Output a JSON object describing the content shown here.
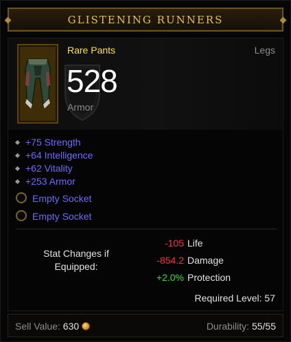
{
  "item": {
    "name": "GLISTENING RUNNERS",
    "rarity_type": "Rare Pants",
    "slot": "Legs",
    "armor_value": "528",
    "armor_label": "Armor"
  },
  "stats": [
    {
      "text": "+75 Strength"
    },
    {
      "text": "+64 Intelligence"
    },
    {
      "text": "+62 Vitality"
    },
    {
      "text": "+253 Armor"
    }
  ],
  "sockets": [
    {
      "text": "Empty Socket"
    },
    {
      "text": "Empty Socket"
    }
  ],
  "stat_changes": {
    "label": "Stat Changes if Equipped:",
    "rows": [
      {
        "value": "-105",
        "name": "Life",
        "color": "#ff3030"
      },
      {
        "value": "-854.2",
        "name": "Damage",
        "color": "#ff3030"
      },
      {
        "value": "+2.0%",
        "name": "Protection",
        "color": "#2ee02e"
      }
    ]
  },
  "required_level": "Required Level: 57",
  "footer": {
    "sell_label": "Sell Value:",
    "sell_value": "630",
    "durability_label": "Durability:",
    "durability_value": "55/55"
  },
  "colors": {
    "title": "#e8c04a",
    "rare": "#ffe14a",
    "magic_stat": "#6b6bff",
    "negative": "#ff3030",
    "positive": "#2ee02e"
  },
  "icons": {
    "item": "pants-icon",
    "armor_bg": "shield-icon",
    "socket": "socket-icon",
    "gold": "gold-coin-icon"
  }
}
